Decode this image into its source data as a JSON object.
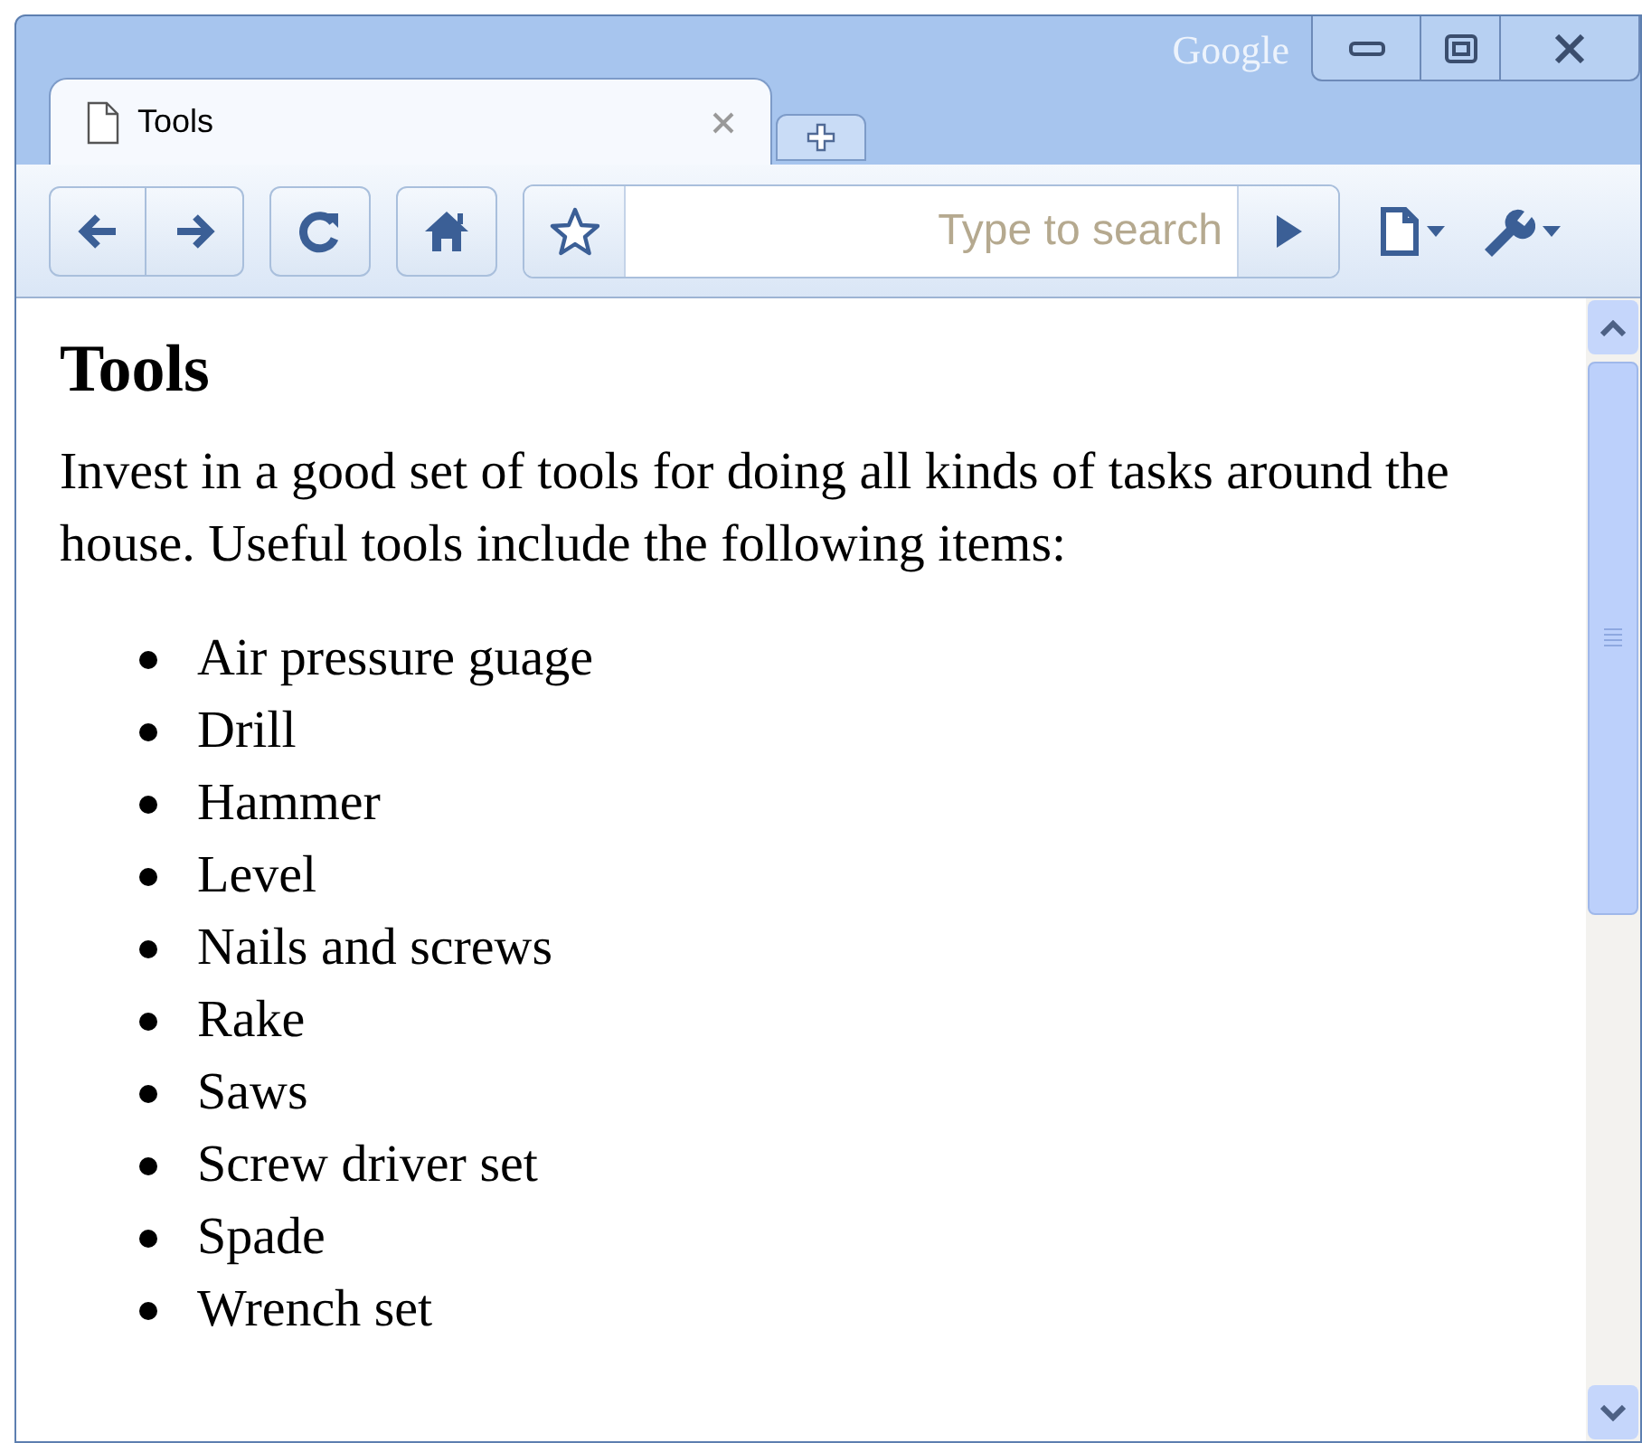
{
  "window": {
    "brand": "Google"
  },
  "tabs": [
    {
      "label": "Tools",
      "selected": true
    }
  ],
  "address_bar": {
    "placeholder": "Type to search"
  },
  "page": {
    "heading": "Tools",
    "paragraph": "Invest in a good set of tools for doing all kinds of tasks around the house. Useful tools include the following items:",
    "items": [
      "Air pressure guage",
      "Drill",
      "Hammer",
      "Level",
      "Nails and screws",
      "Rake",
      "Saws",
      "Screw driver set",
      "Spade",
      "Wrench set"
    ]
  }
}
